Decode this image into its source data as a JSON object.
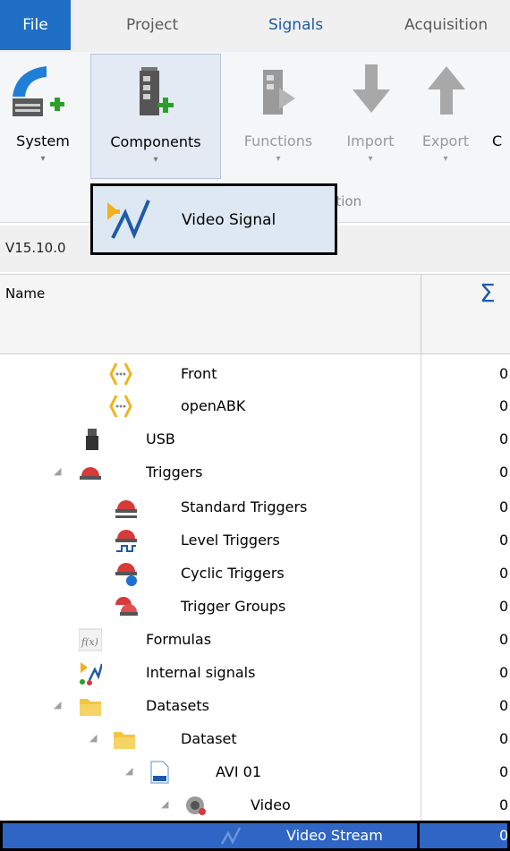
{
  "tabs": [
    {
      "label": "File"
    },
    {
      "label": "Project"
    },
    {
      "label": "Signals"
    },
    {
      "label": "Acquisition"
    }
  ],
  "ribbon": {
    "system_label": "System",
    "components_label": "Components",
    "functions_label": "Functions",
    "import_label": "Import",
    "export_label": "Export",
    "partial_label": "C",
    "group_label": "ration",
    "dropdown_arrow": "▾"
  },
  "dropdown": {
    "item_label": "Video Signal"
  },
  "version": "V15.10.0",
  "grid": {
    "name_header": "Name",
    "sum_header": "Σ"
  },
  "tree": [
    {
      "label": "Front",
      "count": "0",
      "icon": "bracket-signal-icon",
      "expander": ""
    },
    {
      "label": "openABK",
      "count": "0",
      "icon": "bracket-signal-icon",
      "expander": ""
    },
    {
      "label": "USB",
      "count": "0",
      "icon": "usb-device-icon",
      "expander": ""
    },
    {
      "label": "Triggers",
      "count": "0",
      "icon": "trigger-icon",
      "expander": "◢"
    },
    {
      "label": "Standard Triggers",
      "count": "0",
      "icon": "standard-trigger-icon",
      "expander": ""
    },
    {
      "label": "Level Triggers",
      "count": "0",
      "icon": "level-trigger-icon",
      "expander": ""
    },
    {
      "label": "Cyclic Triggers",
      "count": "0",
      "icon": "cyclic-trigger-icon",
      "expander": ""
    },
    {
      "label": "Trigger Groups",
      "count": "0",
      "icon": "trigger-group-icon",
      "expander": ""
    },
    {
      "label": "Formulas",
      "count": "0",
      "icon": "formula-icon",
      "expander": ""
    },
    {
      "label": "Internal signals",
      "count": "0",
      "icon": "internal-signals-icon",
      "expander": ""
    },
    {
      "label": "Datasets",
      "count": "0",
      "icon": "folder-icon",
      "expander": "◢"
    },
    {
      "label": "Dataset",
      "count": "0",
      "icon": "folder-icon",
      "expander": "◢"
    },
    {
      "label": "AVI 01",
      "count": "0",
      "icon": "avi-file-icon",
      "expander": "◢"
    },
    {
      "label": "Video",
      "count": "0",
      "icon": "video-camera-icon",
      "expander": "◢"
    },
    {
      "label": "Video Stream",
      "count": "0",
      "icon": "video-stream-icon",
      "expander": ""
    }
  ],
  "colors": {
    "file_tab": "#1f6fc7",
    "selection": "#2f66c5",
    "signals_tab": "#1e5aa8"
  }
}
